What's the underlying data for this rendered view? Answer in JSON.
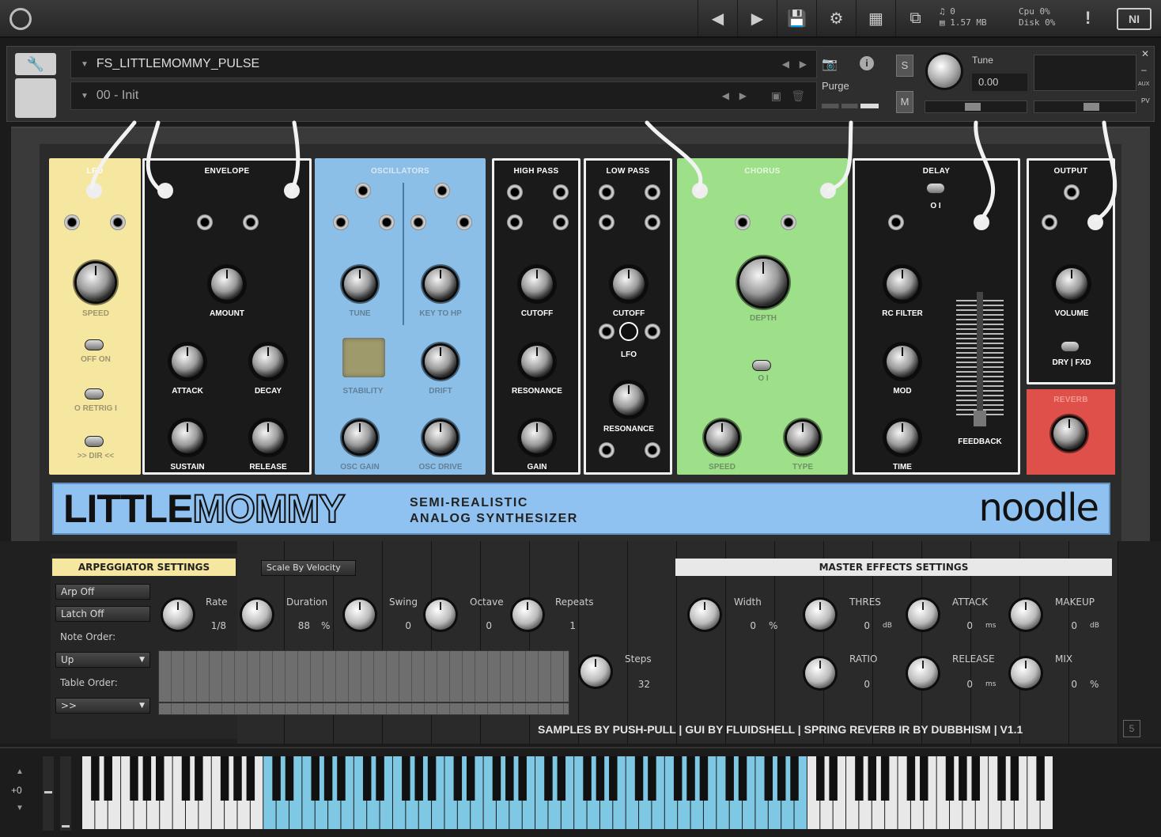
{
  "topbar": {
    "logo": "kontakt-logo",
    "voices": "0",
    "memory": "1.57 MB",
    "cpu_label": "Cpu",
    "cpu_value": "0%",
    "disk_label": "Disk",
    "disk_value": "0%",
    "warning": "!",
    "ni_label": "NI"
  },
  "header": {
    "instrument_name": "FS_LITTLEMOMMY_PULSE",
    "snapshot_name": "00 - Init",
    "purge_label": "Purge",
    "s_label": "S",
    "m_label": "M",
    "tune_label": "Tune",
    "tune_value": "0.00",
    "pv_label": "PV",
    "aux_label": "AUX"
  },
  "modules": {
    "lfo": {
      "title": "LFO",
      "speed": "SPEED",
      "off_on": "OFF   ON",
      "retrig": "O RETRIG I",
      "dir": ">> DIR <<"
    },
    "envelope": {
      "title": "ENVELOPE",
      "amount": "AMOUNT",
      "attack": "ATTACK",
      "decay": "DECAY",
      "sustain": "SUSTAIN",
      "release": "RELEASE"
    },
    "oscillators": {
      "title": "OSCILLATORS",
      "tune": "TUNE",
      "key_to_hp": "KEY TO HP",
      "stability": "STABILITY",
      "drift": "DRIFT",
      "osc_gain": "OSC GAIN",
      "osc_drive": "OSC DRIVE"
    },
    "high_pass": {
      "title": "HIGH PASS",
      "cutoff": "CUTOFF",
      "resonance": "RESONANCE",
      "gain": "GAIN"
    },
    "low_pass": {
      "title": "LOW PASS",
      "cutoff": "CUTOFF",
      "lfo": "LFO",
      "resonance": "RESONANCE"
    },
    "chorus": {
      "title": "CHORUS",
      "depth": "DEPTH",
      "switch": "O   I",
      "speed": "SPEED",
      "type": "TYPE"
    },
    "delay": {
      "title": "DELAY",
      "switch": "O   I",
      "rc_filter": "RC FILTER",
      "mod": "MOD",
      "time": "TIME",
      "feedback": "FEEDBACK"
    },
    "output": {
      "title": "OUTPUT",
      "volume": "VOLUME",
      "dry_fxd": "DRY | FXD"
    },
    "reverb": {
      "title": "REVERB"
    }
  },
  "banner": {
    "title_little": "LITTLE",
    "title_mommy": "MOMMY",
    "subtitle_1": "SEMI-REALISTIC",
    "subtitle_2": "ANALOG SYNTHESIZER",
    "brand": "noodle"
  },
  "arp": {
    "header": "ARPEGGIATOR SETTINGS",
    "scale_by_velocity": "Scale By Velocity",
    "arp_off": "Arp Off",
    "latch_off": "Latch Off",
    "note_order_label": "Note Order:",
    "note_order_value": "Up",
    "table_order_label": "Table Order:",
    "table_order_value": ">>",
    "rate_label": "Rate",
    "rate_value": "1/8",
    "duration_label": "Duration",
    "duration_value": "88",
    "duration_unit": "%",
    "swing_label": "Swing",
    "swing_value": "0",
    "octave_label": "Octave",
    "octave_value": "0",
    "repeats_label": "Repeats",
    "repeats_value": "1",
    "steps_label": "Steps",
    "steps_value": "32"
  },
  "master": {
    "header": "MASTER EFFECTS SETTINGS",
    "width_label": "Width",
    "width_value": "0",
    "width_unit": "%",
    "thres_label": "THRES",
    "thres_value": "0",
    "thres_unit": "dB",
    "attack_label": "ATTACK",
    "attack_value": "0",
    "attack_unit": "ms",
    "makeup_label": "MAKEUP",
    "makeup_value": "0",
    "makeup_unit": "dB",
    "ratio_label": "RATIO",
    "ratio_value": "0",
    "release_label": "RELEASE",
    "release_value": "0",
    "release_unit": "ms",
    "mix_label": "MIX",
    "mix_value": "0",
    "mix_unit": "%"
  },
  "credits": "SAMPLES BY PUSH-PULL  | GUI BY FLUIDSHELL | SPRING REVERB IR BY DUBBHISM  | V1.1",
  "keyboard": {
    "octave_shift": "+0",
    "highlight_color": "#7ec8e3"
  },
  "colors": {
    "lfo": "#f5e6a0",
    "oscillators": "#8bbfe8",
    "chorus": "#9ee08a",
    "reverb": "#e0504a",
    "banner": "#8fc2f0"
  }
}
